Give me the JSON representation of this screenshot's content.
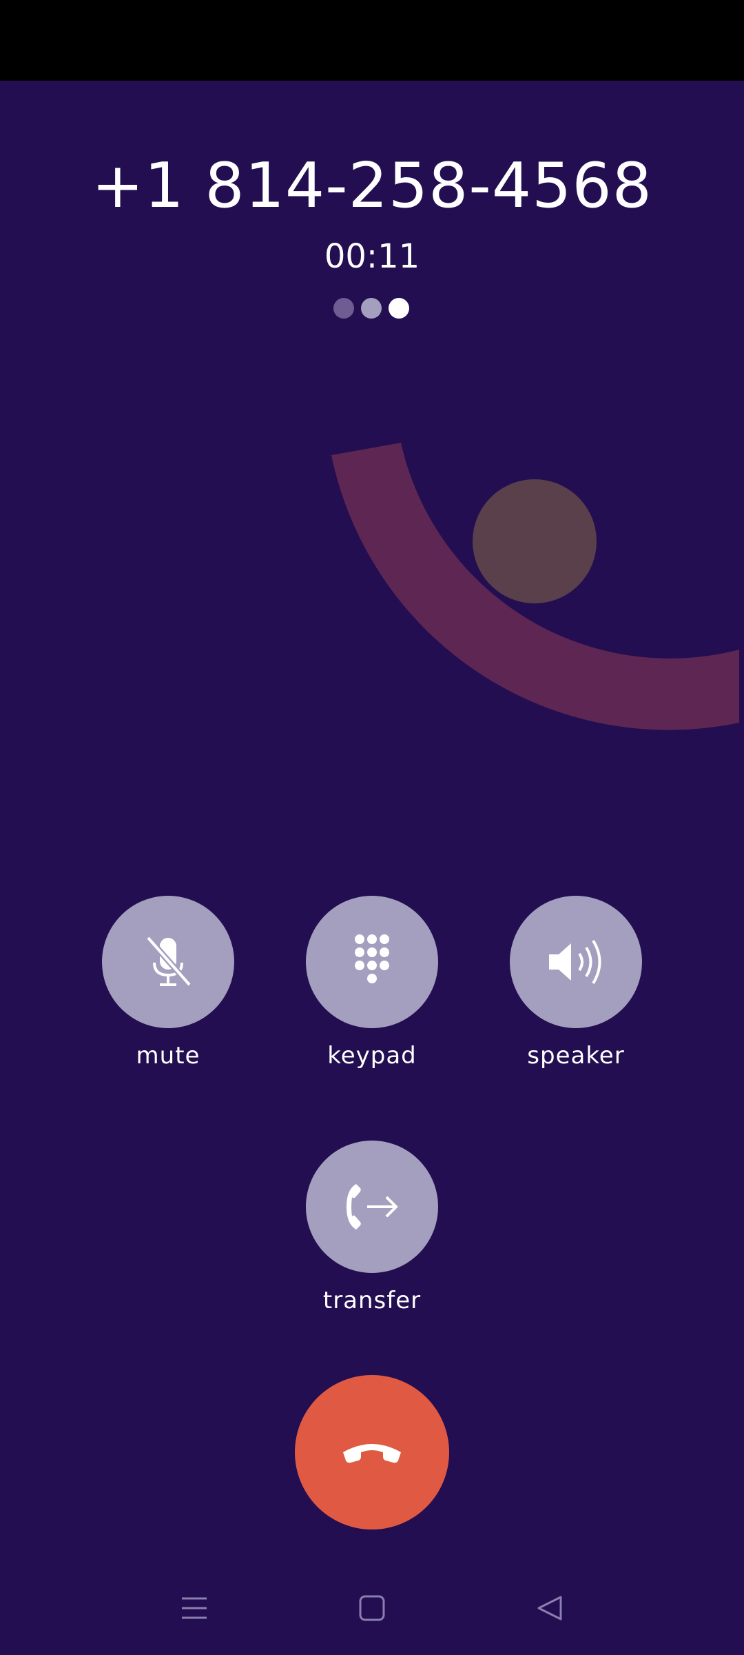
{
  "call": {
    "phone_number": "+1 814-258-4568",
    "timer": "00:11",
    "status_dots": [
      "#6e5c93",
      "#a59fbf",
      "#ffffff"
    ]
  },
  "actions": [
    {
      "label": "mute",
      "icon": "mic-off-icon"
    },
    {
      "label": "keypad",
      "icon": "dialpad-icon"
    },
    {
      "label": "speaker",
      "icon": "speaker-icon"
    },
    {
      "label": "transfer",
      "icon": "call-transfer-icon"
    }
  ],
  "end_call": {
    "icon": "end-call-icon",
    "color": "#e05a43"
  },
  "nav": {
    "items": [
      {
        "icon": "menu-icon"
      },
      {
        "icon": "home-icon"
      },
      {
        "icon": "back-icon"
      }
    ]
  },
  "colors": {
    "background": "#230e51",
    "button": "#a59fbf",
    "arc": "#5e2653",
    "blob": "#59404a"
  }
}
